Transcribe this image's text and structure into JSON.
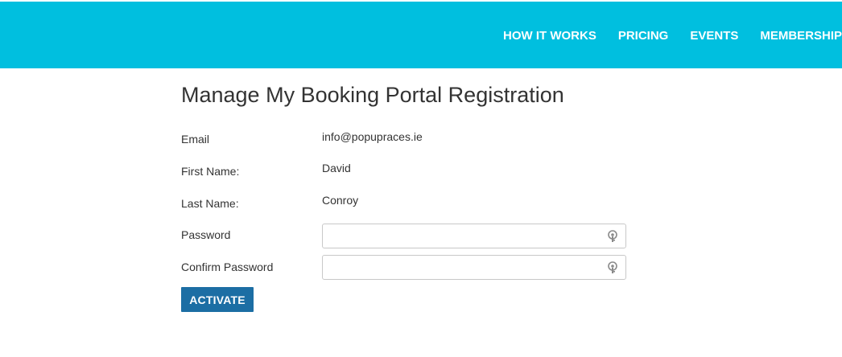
{
  "header": {
    "nav": [
      {
        "label": "HOW IT WORKS"
      },
      {
        "label": "PRICING"
      },
      {
        "label": "EVENTS"
      },
      {
        "label": "MEMBERSHIP"
      }
    ],
    "background_color": "#00bfdf"
  },
  "main": {
    "title": "Manage My Booking Portal Registration",
    "fields": {
      "email": {
        "label": "Email",
        "value": "info@popupraces.ie"
      },
      "first_name": {
        "label": "First Name:",
        "value": "David"
      },
      "last_name": {
        "label": "Last Name:",
        "value": "Conroy"
      },
      "password": {
        "label": "Password",
        "value": ""
      },
      "confirm_password": {
        "label": "Confirm Password",
        "value": ""
      }
    },
    "activate_label": "ACTIVATE",
    "button_color": "#1c6ea4"
  },
  "icons": {
    "password_field_icon": "key-icon"
  }
}
